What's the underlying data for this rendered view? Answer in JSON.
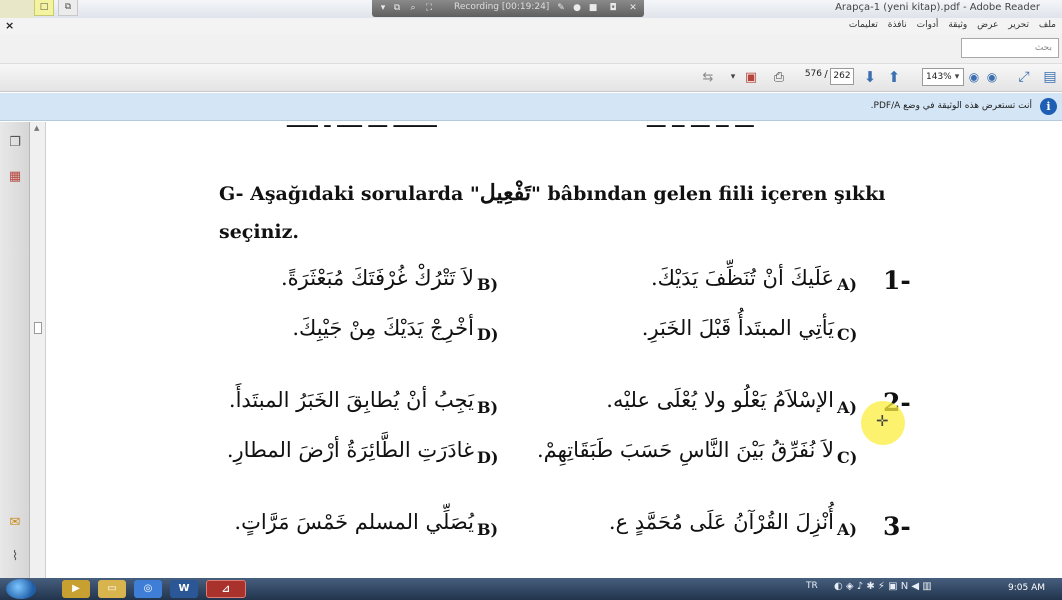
{
  "window": {
    "title": "Arapça-1 (yeni kitap).pdf - Adobe Reader"
  },
  "recording": {
    "label": "Recording [00:19:24]"
  },
  "menu": {
    "close": "×",
    "items": [
      "ملف",
      "تحرير",
      "عرض",
      "وثيقة",
      "أدوات",
      "نافذة",
      "تعليمات"
    ]
  },
  "search": {
    "placeholder": "بحث"
  },
  "toolbar": {
    "current_page": "576",
    "separator": "/",
    "total_pages": "262",
    "zoom": "143%"
  },
  "info": {
    "message": "أنت تستعرض هذه الوثيقة في وضع PDF/A.",
    "icon": "info-icon"
  },
  "document": {
    "heading_prefix": "G- Aşağıdaki sorularda \"",
    "heading_arabic": "تَفْعِيل",
    "heading_suffix": "\"  bâbından gelen fiili içeren şıkkı seçiniz.",
    "questions": [
      {
        "number": "1-",
        "options": [
          {
            "label": "A)",
            "text": "عَلَيكَ أنْ تُنَظِّفَ يَدَيْكَ."
          },
          {
            "label": "B)",
            "text": "لاَ تَتْرُكْ غُرْفَتَكَ مُبَعْثَرَةً."
          },
          {
            "label": "C)",
            "text": "يَأتِي المبتَدأُ قَبْلَ الخَبَرِ."
          },
          {
            "label": "D)",
            "text": "أخْرِجْ يَدَيْكَ مِنْ جَيْبِكَ."
          }
        ]
      },
      {
        "number": "2-",
        "options": [
          {
            "label": "A)",
            "text": "الإسْلاَمُ يَعْلُو ولا يُعْلَى عليْه."
          },
          {
            "label": "B)",
            "text": "يَجِبُ أنْ يُطابِقَ الخَبَرُ المبتَدأَ."
          },
          {
            "label": "C)",
            "text": "لاَ نُفَرِّقُ بَيْنَ النَّاسِ حَسَبَ طَبَقَاتِهِمْ."
          },
          {
            "label": "D)",
            "text": "غادَرَتِ الطَّائِرَةُ أرْضَ المطارِ."
          }
        ]
      },
      {
        "number": "3-",
        "options": [
          {
            "label": "A)",
            "text": "أُنْزِلَ القُرْآنُ عَلَى مُحَمَّدٍ ع."
          },
          {
            "label": "B)",
            "text": "يُصَلِّي المسلم خَمْسَ مَرَّاتٍ."
          }
        ]
      }
    ]
  },
  "taskbar": {
    "language": "TR",
    "clock": "9:05 AM"
  }
}
